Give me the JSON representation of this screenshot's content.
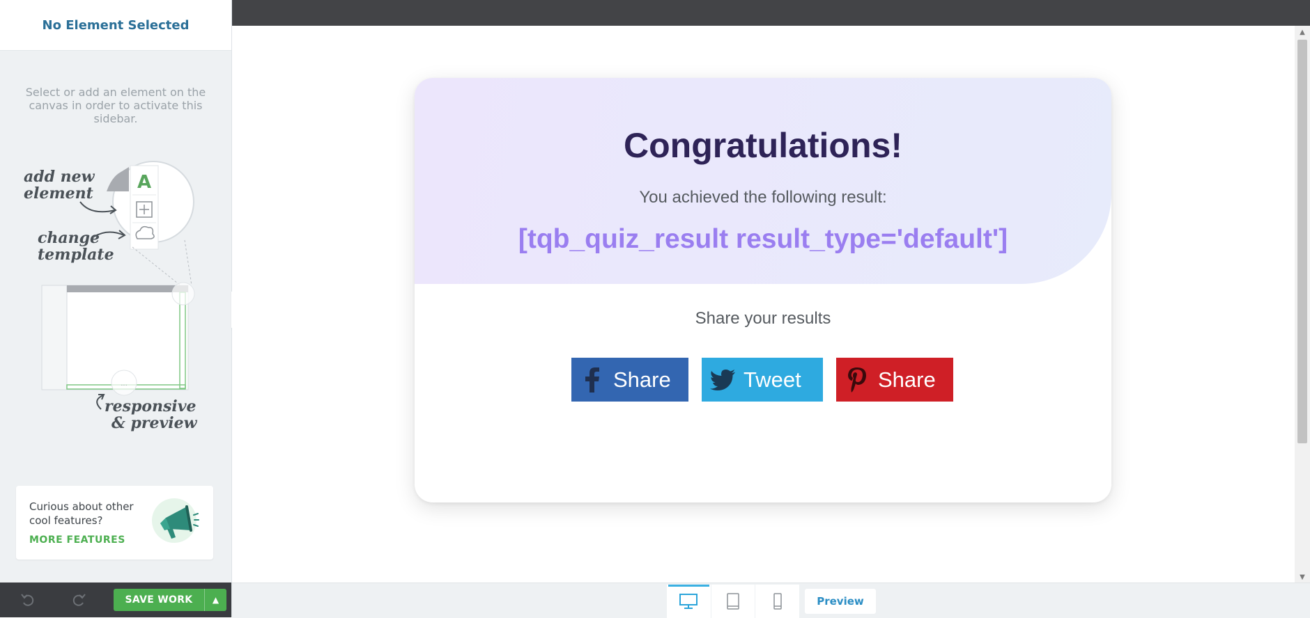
{
  "sidebar": {
    "title": "No Element Selected",
    "description": "Select or add an element on the canvas in order to activate this sidebar.",
    "illustration": {
      "add_new": "add new",
      "element": "element",
      "change": "change",
      "template": "template",
      "responsive": "responsive",
      "and_preview": "& preview"
    },
    "promo": {
      "text": "Curious about other cool features?",
      "link": "MORE FEATURES"
    },
    "footer": {
      "save_label": "SAVE WORK"
    }
  },
  "card": {
    "title": "Congratulations!",
    "subtitle": "You achieved the following result:",
    "result_shortcode": "[tqb_quiz_result result_type='default']",
    "share_heading": "Share your results",
    "buttons": [
      {
        "label": "Share",
        "network": "facebook",
        "color": "#3366b1"
      },
      {
        "label": "Tweet",
        "network": "twitter",
        "color": "#2eaae0"
      },
      {
        "label": "Share",
        "network": "pinterest",
        "color": "#cf1f26"
      }
    ]
  },
  "devicebar": {
    "preview_label": "Preview"
  },
  "colors": {
    "accent": "#4caf50",
    "title": "#2e2357",
    "result": "#9a7ef0"
  }
}
